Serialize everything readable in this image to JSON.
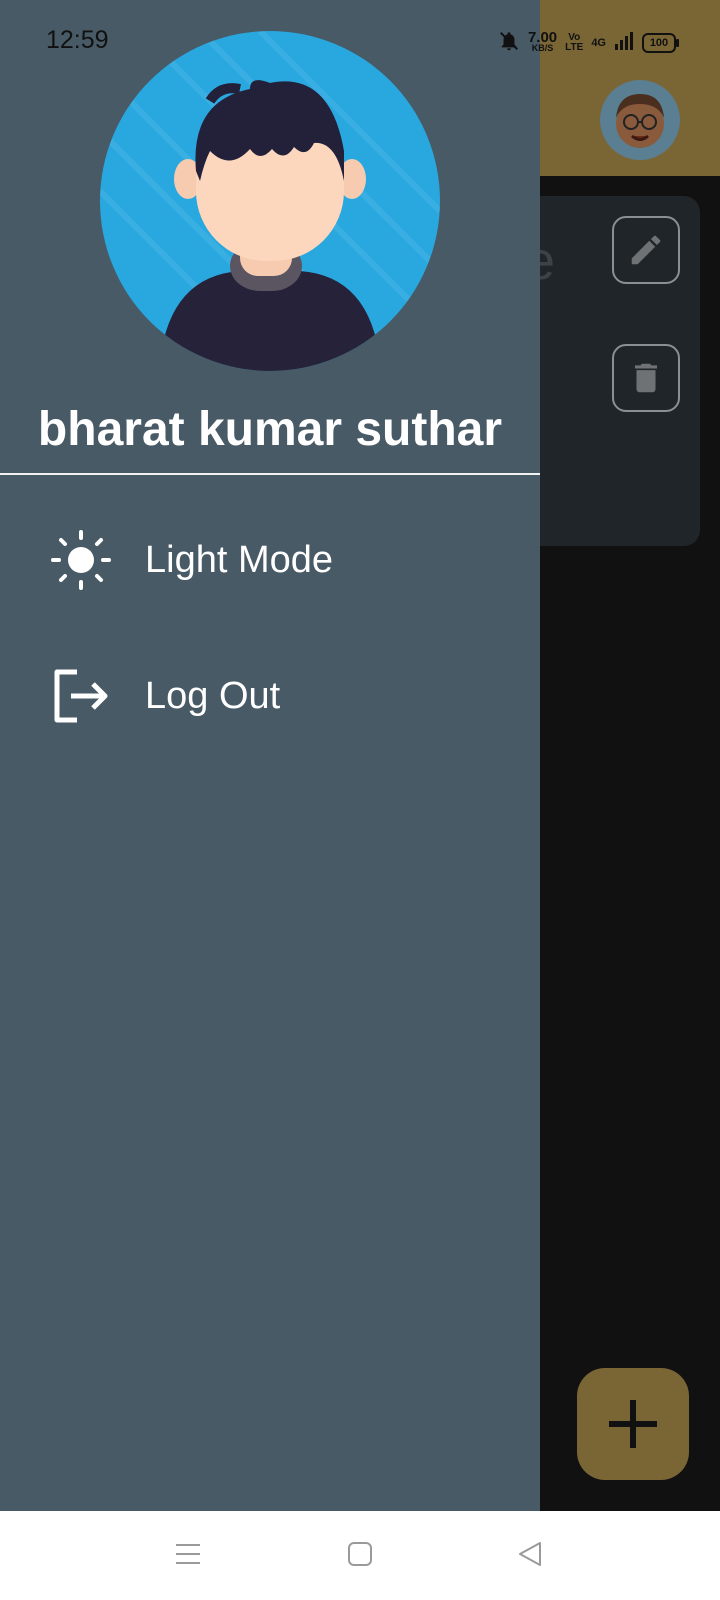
{
  "status_bar": {
    "time": "12:59",
    "speed_value": "7.00",
    "speed_unit": "KB/S",
    "volte_top": "Vo",
    "volte_bottom": "LTE",
    "network": "4G",
    "battery": "100"
  },
  "background_app": {
    "note_title_fragment": "e",
    "icons": [
      "edit-icon",
      "delete-icon",
      "add-icon"
    ],
    "colors": {
      "app_bar": "#7a6535",
      "card": "#1f2529",
      "fab": "#7a6535"
    }
  },
  "drawer": {
    "user_name": "bharat kumar suthar",
    "menu": [
      {
        "label": "Light Mode",
        "icon": "sun-icon"
      },
      {
        "label": "Log Out",
        "icon": "logout-icon"
      }
    ],
    "colors": {
      "background": "#485a66",
      "avatar_bg": "#29a8e0"
    }
  },
  "nav_bar": {
    "icons": [
      "menu-icon",
      "home-icon",
      "back-icon"
    ]
  }
}
